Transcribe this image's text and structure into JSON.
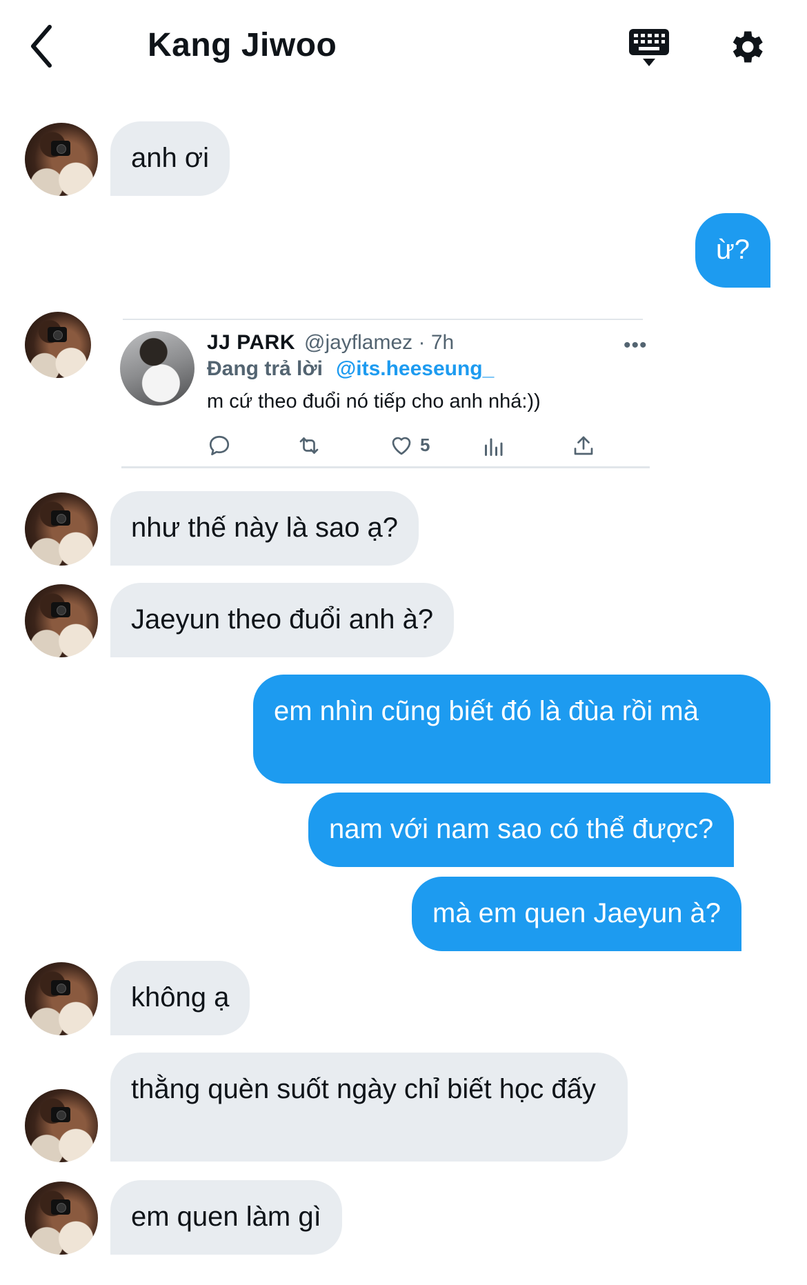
{
  "header": {
    "title": "Kang Jiwoo"
  },
  "colors": {
    "sent_bubble": "#1d9bf0",
    "received_bubble": "#e8ecf0",
    "link": "#1d9bf0"
  },
  "icons": [
    "back-arrow-icon",
    "keyboard-icon",
    "gear-icon"
  ],
  "messages": [
    {
      "from": "them",
      "text": "anh ơi"
    },
    {
      "from": "me",
      "text": "ừ?"
    },
    {
      "from": "them",
      "type": "tweet"
    },
    {
      "from": "them",
      "text": "như thế này là sao ạ?"
    },
    {
      "from": "them",
      "text": "Jaeyun theo đuổi anh à?"
    },
    {
      "from": "me",
      "text": "em nhìn cũng biết đó là đùa rồi mà"
    },
    {
      "from": "me",
      "text": "nam với nam sao có thể được?"
    },
    {
      "from": "me",
      "text": "mà em quen Jaeyun à?"
    },
    {
      "from": "them",
      "text": "không ạ"
    },
    {
      "from": "them",
      "text": "thằng quèn suốt ngày chỉ biết học đấy"
    },
    {
      "from": "them",
      "text": "em quen làm gì"
    }
  ],
  "tweet": {
    "author": "JJ PARK",
    "handle_time": "@jayflamez · 7h",
    "replying_label": "Đang trả lời",
    "replying_to": "@its.heeseung_",
    "text": "m cứ theo đuổi nó tiếp cho anh nhá:))",
    "more": "•••",
    "likes": "5",
    "action_icons": [
      "reply-icon",
      "retweet-icon",
      "like-icon",
      "analytics-icon",
      "share-icon"
    ]
  }
}
